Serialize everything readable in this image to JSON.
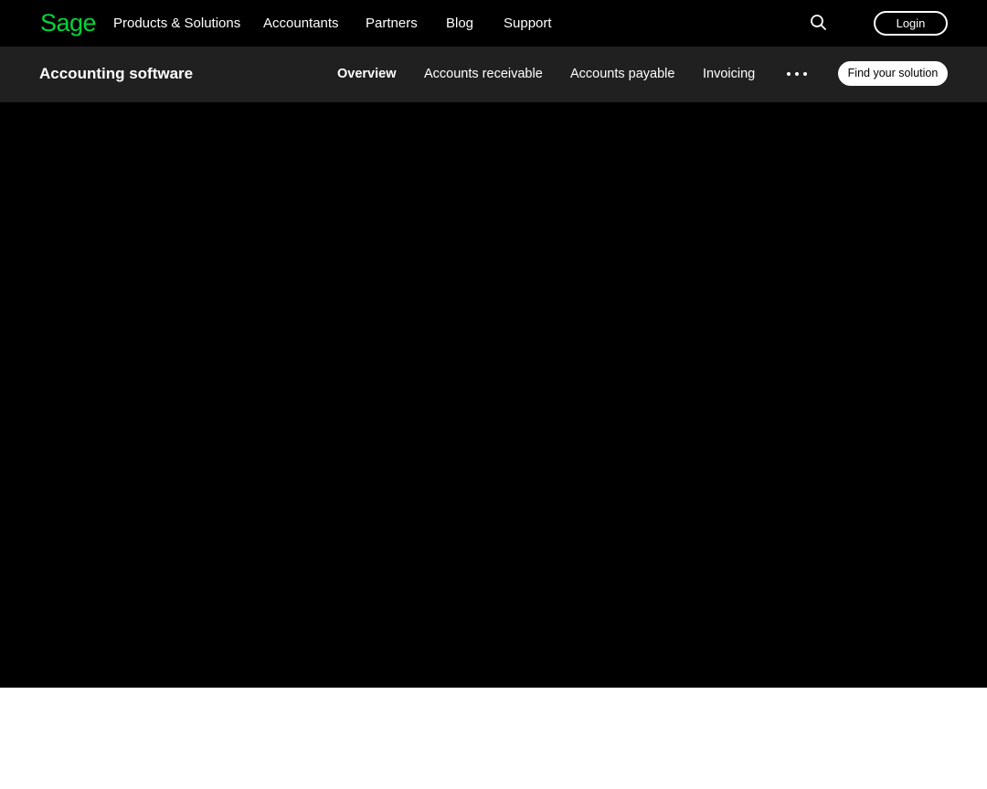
{
  "brand": {
    "logo_text": "Sage",
    "logo_color": "#00d639"
  },
  "top_nav": {
    "links": [
      {
        "label": "Products & Solutions"
      },
      {
        "label": "Accountants"
      },
      {
        "label": "Partners"
      },
      {
        "label": "Blog"
      },
      {
        "label": "Support"
      }
    ],
    "search_icon": "search-icon",
    "login_label": "Login"
  },
  "sub_nav": {
    "title": "Accounting software",
    "links": [
      {
        "label": "Overview",
        "active": true
      },
      {
        "label": "Accounts receivable"
      },
      {
        "label": "Accounts payable"
      },
      {
        "label": "Invoicing"
      }
    ],
    "more_icon": "more-horizontal-icon",
    "cta_label": "Find your solution"
  },
  "colors": {
    "top_nav_bg": "#000000",
    "sub_nav_bg": "#202020",
    "hero_bg": "#000000",
    "page_bg": "#ffffff"
  }
}
